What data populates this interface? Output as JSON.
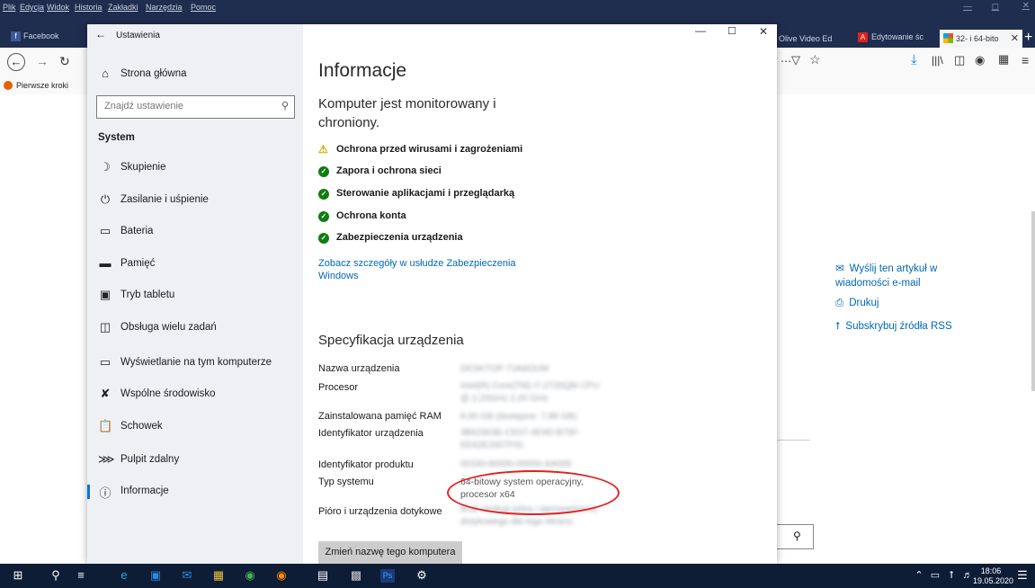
{
  "firefox": {
    "menu": [
      "Plik",
      "Edycja",
      "Widok",
      "Historia",
      "Zakładki",
      "Narzędzia",
      "Pomoc"
    ],
    "tabs": [
      {
        "label": "Facebook"
      },
      {
        "label": "Olive Video Ed"
      },
      {
        "label": "Edytowanie śc"
      },
      {
        "label": "32- i 64-bito"
      }
    ],
    "bookmark": "Pierwsze kroki"
  },
  "webpage": {
    "email_link": "Wyślij ten artykuł w wiadomości e-mail",
    "print_link": "Drukuj",
    "rss_link": "Subskrybuj źródła RSS"
  },
  "settings": {
    "window_title": "Ustawienia",
    "home": "Strona główna",
    "search_placeholder": "Znajdź ustawienie",
    "section": "System",
    "nav": [
      {
        "label": "Skupienie",
        "icon": "focus-moon-icon"
      },
      {
        "label": "Zasilanie i uśpienie",
        "icon": "power-icon"
      },
      {
        "label": "Bateria",
        "icon": "battery-icon"
      },
      {
        "label": "Pamięć",
        "icon": "storage-icon"
      },
      {
        "label": "Tryb tabletu",
        "icon": "tablet-icon"
      },
      {
        "label": "Obsługa wielu zadań",
        "icon": "multitasking-icon"
      },
      {
        "label": "Wyświetlanie na tym komputerze",
        "icon": "projecting-icon"
      },
      {
        "label": "Wspólne środowisko",
        "icon": "shared-experiences-icon"
      },
      {
        "label": "Schowek",
        "icon": "clipboard-icon"
      },
      {
        "label": "Pulpit zdalny",
        "icon": "remote-desktop-icon"
      },
      {
        "label": "Informacje",
        "icon": "info-icon"
      }
    ],
    "page_title": "Informacje",
    "protection_heading": "Komputer jest monitorowany i chroniony.",
    "protection_items": [
      {
        "label": "Ochrona przed wirusami i zagrożeniami",
        "status": "warning"
      },
      {
        "label": "Zapora i ochrona sieci",
        "status": "ok"
      },
      {
        "label": "Sterowanie aplikacjami i przeglądarką",
        "status": "ok"
      },
      {
        "label": "Ochrona konta",
        "status": "ok"
      },
      {
        "label": "Zabezpieczenia urządzenia",
        "status": "ok"
      }
    ],
    "security_link": "Zobacz szczegóły w usłudze Zabezpieczenia Windows",
    "spec_heading": "Specyfikacja urządzenia",
    "specs": [
      {
        "key": "Nazwa urządzenia",
        "value": "DESKTOP-7VA6OUM"
      },
      {
        "key": "Procesor",
        "value": "Intel(R) Core(TM) i7-2720QM CPU @ 2,20GHz 2,20 GHz"
      },
      {
        "key": "Zainstalowana pamięć RAM",
        "value": "8,00 GB (dostępne: 7,88 GB)"
      },
      {
        "key": "Identyfikator urządzenia",
        "value": "3B62903E-CE07-4E9D-B75F-EE62E2607F91"
      },
      {
        "key": "Identyfikator produktu",
        "value": "00330-80000-00000-AA006"
      },
      {
        "key": "Typ systemu",
        "value": "64-bitowy system operacyjny, procesor x64"
      },
      {
        "key": "Pióro i urządzenia dotykowe",
        "value": "Brak obsługi pióra i wprowadzania dotykowego dla tego ekranu"
      }
    ],
    "rename_button": "Zmień nazwę tego komputera"
  },
  "taskbar": {
    "time": "18:06",
    "date": "19.05.2020"
  },
  "colors": {
    "accent": "#0078d7",
    "link": "#0067b8",
    "ok": "#107c10",
    "warning": "#d8a800",
    "annotation": "#e02020"
  }
}
